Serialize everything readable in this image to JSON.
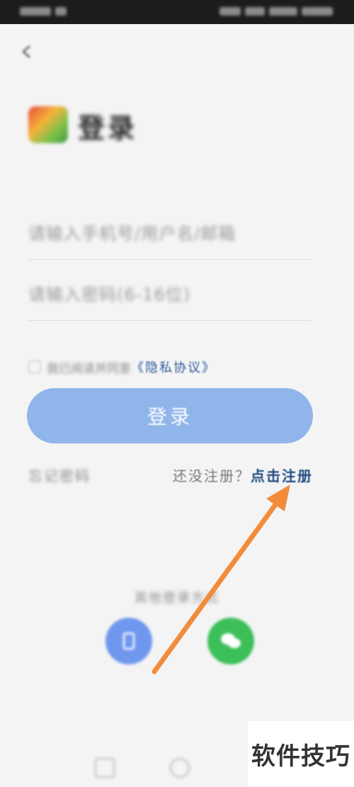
{
  "status_bar": {
    "time": "",
    "indicators": ""
  },
  "header": {
    "back_icon": "arrow-left-icon"
  },
  "app": {
    "title": "登录",
    "subtitle": "",
    "logo_icon": "app-logo-icon"
  },
  "form": {
    "phone_placeholder": "请输入手机号/用户名/邮箱",
    "password_placeholder": "请输入密码(6-16位)",
    "agree_text": "我已阅读并同意",
    "privacy_link": "《隐私协议》",
    "login_label": "登录"
  },
  "links": {
    "forgot_password": "忘记密码",
    "no_account": "还没注册？",
    "register_link": "点击注册"
  },
  "other_login": {
    "title": "其他登录方式",
    "items": [
      {
        "label": "",
        "icon": "phone-login-icon",
        "color": "#6f97ee"
      },
      {
        "label": "",
        "icon": "wechat-icon",
        "color": "#3cbf59"
      }
    ]
  },
  "annotation": {
    "arrow_color": "#f28c3a"
  },
  "watermark": {
    "text": "软件技巧"
  },
  "colors": {
    "primary_button": "#8fb5ea",
    "link": "#1f4a7f"
  }
}
